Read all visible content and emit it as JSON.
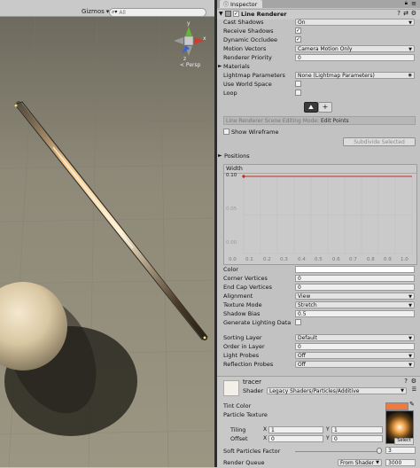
{
  "scene": {
    "gizmos_label": "Gizmos",
    "search_placeholder": "All",
    "axis_y": "y",
    "axis_x": "x",
    "axis_z": "z",
    "persp_label": "< Persp"
  },
  "inspector": {
    "tab_label": "Inspector",
    "component_title": "Line Renderer",
    "rows": {
      "cast_shadows": {
        "label": "Cast Shadows",
        "value": "On"
      },
      "receive_shadows": {
        "label": "Receive Shadows",
        "checked": true
      },
      "dynamic_occludee": {
        "label": "Dynamic Occludee",
        "checked": true
      },
      "motion_vectors": {
        "label": "Motion Vectors",
        "value": "Camera Motion Only"
      },
      "renderer_priority": {
        "label": "Renderer Priority",
        "value": "0"
      },
      "materials": {
        "label": "Materials"
      },
      "lightmap_parameters": {
        "label": "Lightmap Parameters",
        "value": "None (Lightmap Parameters)"
      },
      "use_world_space": {
        "label": "Use World Space",
        "checked": false
      },
      "loop": {
        "label": "Loop",
        "checked": false
      }
    },
    "edit_mode_label": "Line Renderer Scene Editing Mode:",
    "edit_mode_value": "Edit Points",
    "show_wireframe_label": "Show Wireframe",
    "subdivide_label": "Subdivide Selected",
    "positions_label": "Positions",
    "width_label": "Width",
    "width_value": "0.10",
    "curve": {
      "y_ticks": [
        "0.10",
        "0.05",
        "0.00"
      ],
      "x_ticks": [
        "0.0",
        "0.1",
        "0.2",
        "0.3",
        "0.4",
        "0.5",
        "0.6",
        "0.7",
        "0.8",
        "0.9",
        "1.0"
      ]
    },
    "rows2": {
      "color": {
        "label": "Color"
      },
      "corner_vertices": {
        "label": "Corner Vertices",
        "value": "0"
      },
      "end_cap_vertices": {
        "label": "End Cap Vertices",
        "value": "0"
      },
      "alignment": {
        "label": "Alignment",
        "value": "View"
      },
      "texture_mode": {
        "label": "Texture Mode",
        "value": "Stretch"
      },
      "shadow_bias": {
        "label": "Shadow Bias",
        "value": "0.5"
      },
      "generate_lighting_data": {
        "label": "Generate Lighting Data",
        "checked": false
      },
      "sorting_layer": {
        "label": "Sorting Layer",
        "value": "Default"
      },
      "order_in_layer": {
        "label": "Order in Layer",
        "value": "0"
      },
      "light_probes": {
        "label": "Light Probes",
        "value": "Off"
      },
      "reflection_probes": {
        "label": "Reflection Probes",
        "value": "Off"
      }
    },
    "material": {
      "name": "tracer",
      "shader_label": "Shader",
      "shader_value": "Legacy Shaders/Particles/Additive",
      "tint_color_label": "Tint Color",
      "particle_texture_label": "Particle Texture",
      "tiling_label": "Tiling",
      "offset_label": "Offset",
      "tiling_x_label": "X",
      "tiling_x": "1",
      "tiling_y_label": "Y",
      "tiling_y": "1",
      "offset_x_label": "X",
      "offset_x": "0",
      "offset_y_label": "Y",
      "offset_y": "0",
      "select_label": "Select",
      "soft_particles_label": "Soft Particles Factor",
      "soft_particles_value": "3",
      "render_queue_label": "Render Queue",
      "render_queue_mode": "From Shader",
      "render_queue_value": "3000"
    },
    "colors": {
      "curve_red": "#cc2a1c",
      "tint_swatch": "#f07a3d",
      "edit_mode_accent": "#2d2d2d"
    }
  }
}
